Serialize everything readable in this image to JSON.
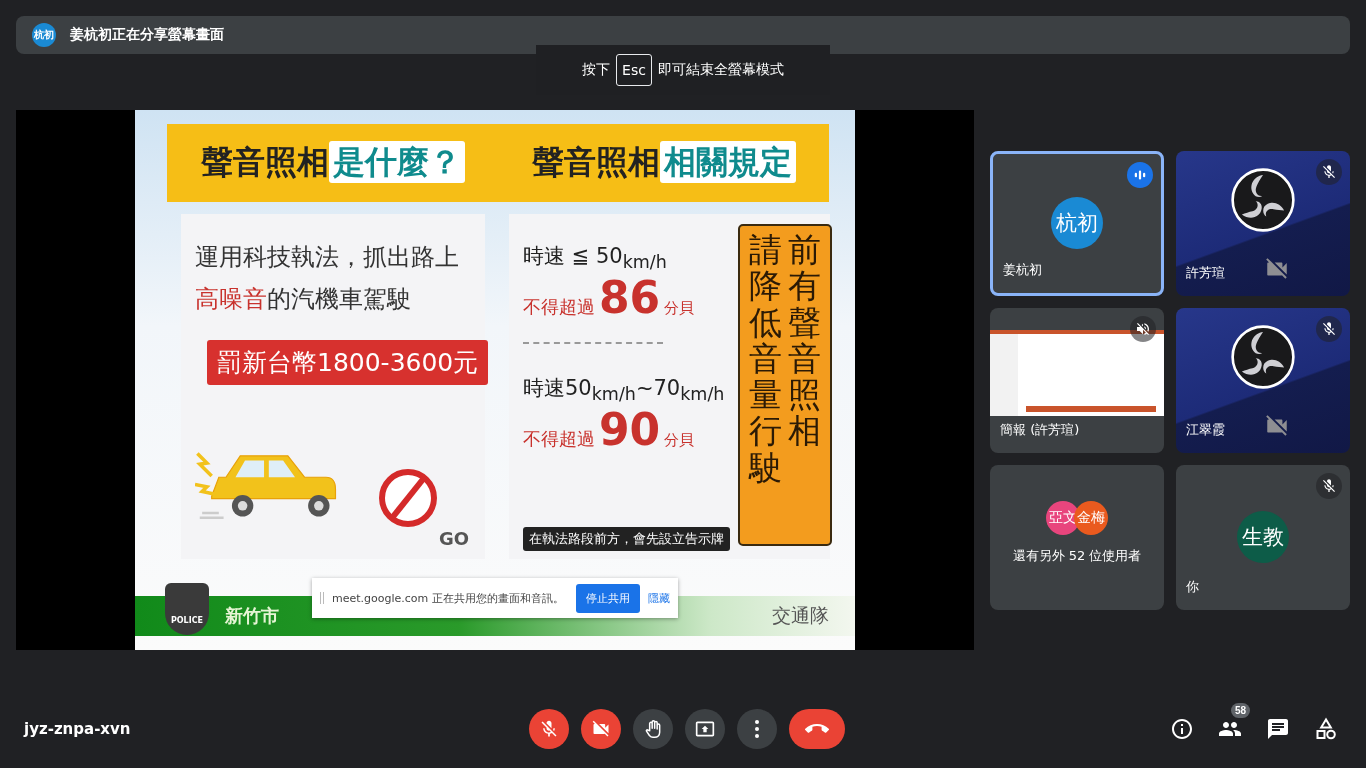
{
  "banner": {
    "avatar": "杭初",
    "color": "#1a8ad4",
    "text": "姜杭初正在分享螢幕畫面"
  },
  "fullscreen_hint": {
    "before": "按下",
    "key": "Esc",
    "after": "即可結束全螢幕模式"
  },
  "slide": {
    "headings": [
      {
        "text": "聲音照相",
        "highlight": "是什麼？"
      },
      {
        "text": "聲音照相",
        "highlight": "相關規定"
      }
    ],
    "description": {
      "line_1": "運用科技執法，抓出路上",
      "line_2_highlight": "高噪音",
      "line_2": "的汽機車駕駛"
    },
    "fine": "罰新台幣1800-3600元",
    "go_sign": "GO",
    "rules": [
      {
        "speed": "時速 ≦ 50$_{km/h}$",
        "limit_prefix": "不得超過",
        "limit": "86",
        "unit": "分貝"
      },
      {
        "speed": "時速50$_{km/h}$~70$_{km/h}$",
        "limit_prefix": "不得超過",
        "limit": "90",
        "unit": "分貝"
      }
    ],
    "notice": "在執法路段前方，會先設立告示牌",
    "sign_columns": [
      "請降低音量行駛",
      "前有聲音照相"
    ],
    "badge": "POLICE",
    "footer_left": "新竹市",
    "footer_right": "交通隊"
  },
  "share_notice": {
    "text": "meet.google.com 正在共用您的畫面和音訊。",
    "stop_button": "停止共用",
    "hide_link": "隱藏"
  },
  "tiles": [
    {
      "kind": "avatar",
      "name": "姜杭初",
      "avatar": "杭初",
      "color": "#1a8ad4",
      "speaking": true,
      "muted": false,
      "camera_off": false
    },
    {
      "kind": "obs",
      "name": "許芳瑄",
      "speaking": false,
      "muted": true,
      "camera_off": true
    },
    {
      "kind": "presentation",
      "name": "簡報 (許芳瑄)",
      "speaking": false,
      "muted": true,
      "camera_off": false
    },
    {
      "kind": "obs",
      "name": "江翠霞",
      "speaking": false,
      "muted": true,
      "camera_off": true
    },
    {
      "kind": "others",
      "text": "還有另外 52 位使用者",
      "avatars": [
        {
          "initials": "亞文",
          "color": "#e8457d"
        },
        {
          "initials": "金梅",
          "color": "#ea5a1e"
        }
      ],
      "speaking": false,
      "muted": false,
      "camera_off": false
    },
    {
      "kind": "avatar",
      "name": "你",
      "avatar": "生教",
      "color": "#0d5c48",
      "speaking": false,
      "muted": true,
      "camera_off": false
    }
  ],
  "meeting_code": "jyz-znpa-xvn",
  "controls": [
    {
      "kind": "mic",
      "on": false
    },
    {
      "kind": "camera",
      "on": false
    },
    {
      "kind": "hand"
    },
    {
      "kind": "present"
    },
    {
      "kind": "more"
    },
    {
      "kind": "leave"
    }
  ],
  "side_buttons": [
    {
      "kind": "info"
    },
    {
      "kind": "people",
      "badge": "58"
    },
    {
      "kind": "chat"
    },
    {
      "kind": "activities"
    }
  ]
}
